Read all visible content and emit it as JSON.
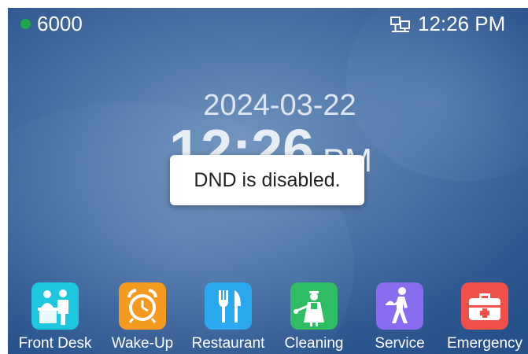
{
  "status_bar": {
    "extension": "6000",
    "time": "12:26 PM",
    "registration_color": "#1faa4a",
    "network_icon": "network-icon"
  },
  "home": {
    "date": "2024-03-22",
    "time": "12:26",
    "ampm": "PM"
  },
  "toast": {
    "message": "DND is disabled."
  },
  "dock": {
    "apps": [
      {
        "label": "Front Desk",
        "icon": "front-desk-icon",
        "color": "#1ec7e0"
      },
      {
        "label": "Wake-Up",
        "icon": "alarm-clock-icon",
        "color": "#f39a1f"
      },
      {
        "label": "Restaurant",
        "icon": "fork-knife-icon",
        "color": "#2aa8f0"
      },
      {
        "label": "Cleaning",
        "icon": "cleaning-icon",
        "color": "#2fbd63"
      },
      {
        "label": "Service",
        "icon": "service-icon",
        "color": "#8a6cf0"
      },
      {
        "label": "Emergency",
        "icon": "first-aid-kit-icon",
        "color": "#f0504a"
      }
    ]
  }
}
